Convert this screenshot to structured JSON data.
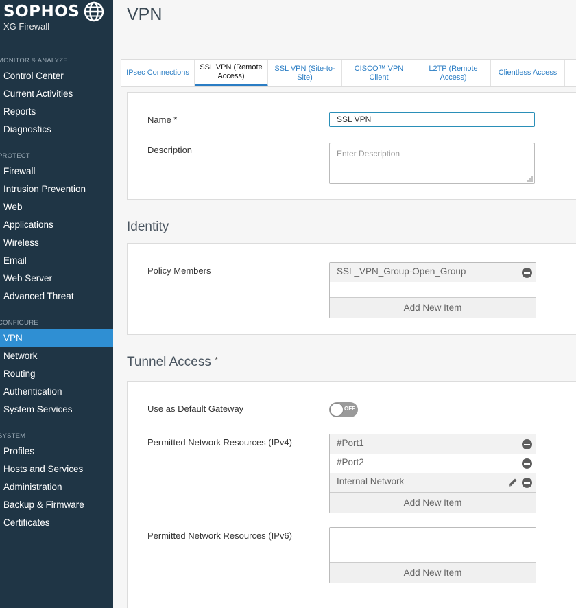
{
  "sidebar": {
    "brand": "SOPHOS",
    "product": "XG Firewall",
    "sections": [
      {
        "title": "MONITOR & ANALYZE",
        "items": [
          "Control Center",
          "Current Activities",
          "Reports",
          "Diagnostics"
        ]
      },
      {
        "title": "PROTECT",
        "items": [
          "Firewall",
          "Intrusion Prevention",
          "Web",
          "Applications",
          "Wireless",
          "Email",
          "Web Server",
          "Advanced Threat"
        ]
      },
      {
        "title": "CONFIGURE",
        "items": [
          "VPN",
          "Network",
          "Routing",
          "Authentication",
          "System Services"
        ]
      },
      {
        "title": "SYSTEM",
        "items": [
          "Profiles",
          "Hosts and Services",
          "Administration",
          "Backup & Firmware",
          "Certificates"
        ]
      }
    ],
    "active_item": "VPN",
    "colors": {
      "background": "#1f3545",
      "active": "#2f8fd3"
    }
  },
  "page": {
    "title": "VPN"
  },
  "tabs": [
    {
      "label": "IPsec Connections",
      "active": false
    },
    {
      "label": "SSL VPN (Remote Access)",
      "active": true
    },
    {
      "label": "SSL VPN (Site-to-Site)",
      "active": false
    },
    {
      "label": "CISCO™ VPN Client",
      "active": false
    },
    {
      "label": "L2TP (Remote Access)",
      "active": false
    },
    {
      "label": "Clientless Access",
      "active": false
    }
  ],
  "general": {
    "name_label": "Name *",
    "name_value": "SSL VPN",
    "description_label": "Description",
    "description_placeholder": "Enter Description"
  },
  "identity": {
    "heading": "Identity",
    "policy_members_label": "Policy Members",
    "policy_members": [
      "SSL_VPN_Group-Open_Group"
    ],
    "add_new_label": "Add New Item"
  },
  "tunnel_access": {
    "heading": "Tunnel Access",
    "required_mark": "*",
    "default_gateway_label": "Use as Default Gateway",
    "default_gateway_state": "OFF",
    "ipv4_label": "Permitted Network Resources (IPv4)",
    "ipv4_items": [
      "#Port1",
      "#Port2",
      "Internal Network"
    ],
    "ipv4_add_label": "Add New Item",
    "ipv6_label": "Permitted Network Resources (IPv6)",
    "ipv6_add_label": "Add New Item"
  },
  "accent_color": "#2a7dc4"
}
